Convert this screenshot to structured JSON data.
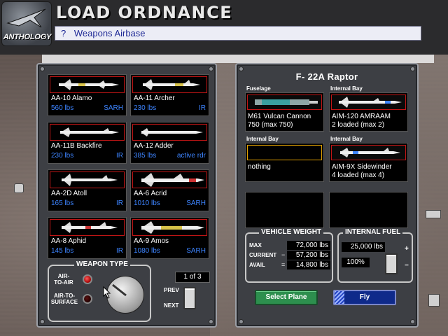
{
  "app": {
    "logo_text": "ANTHOLOGY",
    "title": "LOAD ORDNANCE",
    "breadcrumb_icon": "?",
    "breadcrumb_text": "Weapons Airbase"
  },
  "weapons": [
    {
      "name": "AA-10 Alamo",
      "weight": "560 lbs",
      "guidance": "SARH"
    },
    {
      "name": "AA-11 Archer",
      "weight": "230 lbs",
      "guidance": "IR"
    },
    {
      "name": "AA-11B Backfire",
      "weight": "230 lbs",
      "guidance": "IR"
    },
    {
      "name": "AA-12 Adder",
      "weight": "385 lbs",
      "guidance": "active rdr"
    },
    {
      "name": "AA-2D Atoll",
      "weight": "165 lbs",
      "guidance": "IR"
    },
    {
      "name": "AA-6 Acrid",
      "weight": "1010 lbs",
      "guidance": "SARH"
    },
    {
      "name": "AA-8 Aphid",
      "weight": "145 lbs",
      "guidance": "IR"
    },
    {
      "name": "AA-9 Amos",
      "weight": "1080 lbs",
      "guidance": "SARH"
    }
  ],
  "weapon_type": {
    "title": "WEAPON TYPE",
    "air_to_air": "AIR-TO-AIR",
    "air_to_surface": "AIR-TO-SURFACE"
  },
  "pager": {
    "page": "1 of 3",
    "prev": "PREV",
    "next": "NEXT"
  },
  "plane": {
    "name": "F- 22A Raptor",
    "slots": [
      {
        "label": "Fuselage",
        "line1": "M61 Vulcan Cannon",
        "line2": "750 (max 750)"
      },
      {
        "label": "Internal Bay",
        "line1": "AIM-120 AMRAAM",
        "line2": "2 loaded (max 2)"
      },
      {
        "label": "Internal Bay",
        "line1": "nothing",
        "line2": ""
      },
      {
        "label": "Internal Bay",
        "line1": "AIM-9X Sidewinder",
        "line2": "4 loaded (max 4)"
      }
    ]
  },
  "vehicle_weight": {
    "title": "VEHICLE WEIGHT",
    "max_label": "MAX",
    "current_label": "CURRENT",
    "avail_label": "AVAIL",
    "op_current": "−",
    "op_avail": "=",
    "max": "72,000 lbs",
    "current": "57,200 lbs",
    "avail": "14,800 lbs"
  },
  "internal_fuel": {
    "title": "INTERNAL FUEL",
    "amount": "25,000 lbs",
    "percent": "100%",
    "plus": "+",
    "minus": "−"
  },
  "actions": {
    "select_plane": "Select Plane",
    "fly": "Fly"
  },
  "colors": {
    "accent_blue": "#3d84ff",
    "slot_border_red": "#c01515",
    "empty_slot_border": "#e0a000",
    "select_green": "#2d8f4e",
    "fly_blue": "#0f2a8a"
  }
}
